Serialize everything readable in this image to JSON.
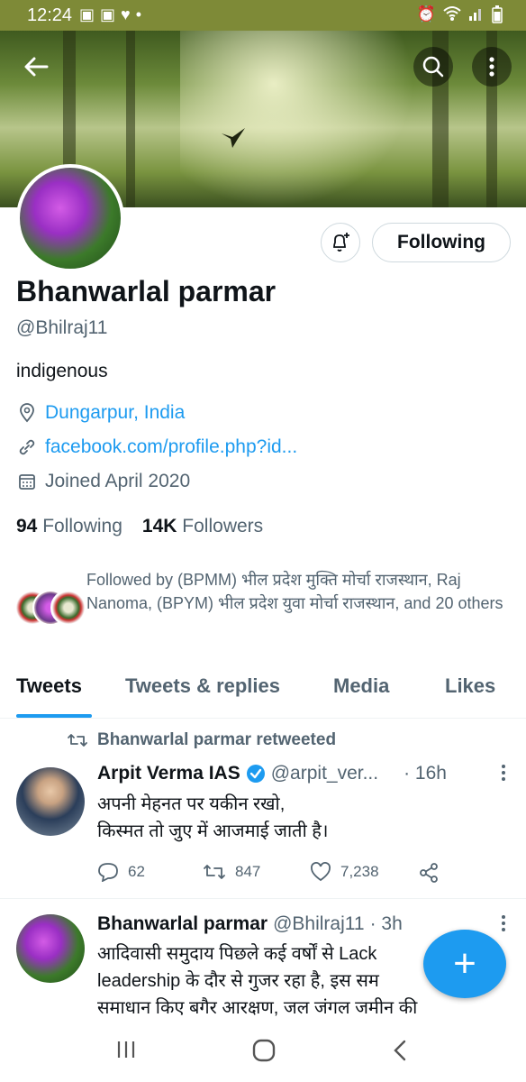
{
  "status_bar": {
    "time": "12:24",
    "left_icons": [
      "app-icon",
      "app-icon",
      "heart-icon",
      "dot"
    ],
    "right_icons": [
      "alarm-icon",
      "wifi-icon",
      "signal-icon",
      "battery-icon"
    ]
  },
  "header": {
    "back_icon": "back-arrow-icon",
    "search_icon": "search-icon",
    "more_icon": "more-vertical-icon"
  },
  "profile": {
    "name": "Bhanwarlal parmar",
    "handle": "@Bhilraj11",
    "bio": "indigenous",
    "location": "Dungarpur, India",
    "website": "facebook.com/profile.php?id...",
    "joined": "Joined April 2020",
    "following_count": "94",
    "following_label": "Following",
    "followers_count": "14K",
    "followers_label": "Followers",
    "followed_by": "Followed by (BPMM) भील प्रदेश मुक्ति मोर्चा राजस्थान, Raj Nanoma, (BPYM) भील प्रदेश युवा मोर्चा राजस्थान, and 20 others",
    "follow_button": "Following"
  },
  "tabs": [
    "Tweets",
    "Tweets & replies",
    "Media",
    "Likes"
  ],
  "active_tab": "Tweets",
  "tweets": [
    {
      "retweet_label": "Bhanwarlal parmar retweeted",
      "name": "Arpit Verma IAS",
      "verified": true,
      "handle": "@arpit_ver...",
      "time": "· 16h",
      "line1": "अपनी मेहनत पर यकीन रखो,",
      "line2": "किस्मत तो जुए में आजमाई जाती है।",
      "replies": "62",
      "retweets": "847",
      "likes": "7,238"
    },
    {
      "name": "Bhanwarlal parmar",
      "handle": "@Bhilraj11",
      "time": "· 3h",
      "line1": "आदिवासी समुदाय पिछले कई वर्षों से Lack",
      "line2": "leadership के दौर से गुजर रहा है, इस सम",
      "line3": "समाधान किए बगैर आरक्षण, जल जंगल जमीन की"
    }
  ],
  "fab": {
    "icon": "plus-icon",
    "label": "+"
  },
  "colors": {
    "accent": "#1d9bf0",
    "status_bar": "#7e8a37",
    "text_secondary": "#536471"
  }
}
